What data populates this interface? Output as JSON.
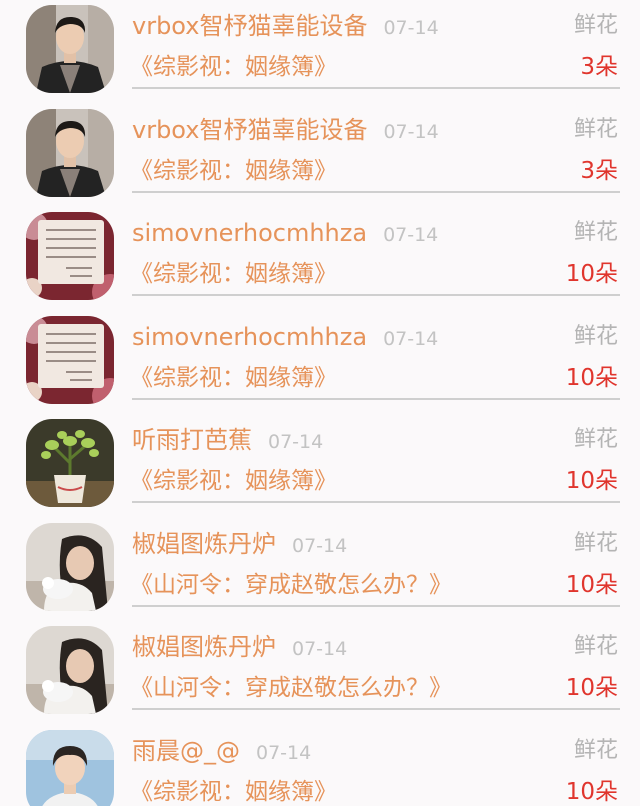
{
  "gifts": [
    {
      "user": "vrbox智杼猫辜能设备",
      "date": "07-14",
      "gift": "鲜花",
      "book": "《综影视：姻缘簿》",
      "count": "3朵",
      "avatar": "man-avatar-icon"
    },
    {
      "user": "vrbox智杼猫辜能设备",
      "date": "07-14",
      "gift": "鲜花",
      "book": "《综影视：姻缘簿》",
      "count": "3朵",
      "avatar": "man-avatar-icon"
    },
    {
      "user": "simovnerhocmhhza",
      "date": "07-14",
      "gift": "鲜花",
      "book": "《综影视：姻缘簿》",
      "count": "10朵",
      "avatar": "poem-card-avatar-icon"
    },
    {
      "user": "simovnerhocmhhza",
      "date": "07-14",
      "gift": "鲜花",
      "book": "《综影视：姻缘簿》",
      "count": "10朵",
      "avatar": "poem-card-avatar-icon"
    },
    {
      "user": "听雨打芭蕉",
      "date": "07-14",
      "gift": "鲜花",
      "book": "《综影视：姻缘簿》",
      "count": "10朵",
      "avatar": "potted-plant-avatar-icon"
    },
    {
      "user": "椒娼图炼丹炉",
      "date": "07-14",
      "gift": "鲜花",
      "book": "《山河令：穿成赵敬怎么办？》",
      "count": "10朵",
      "avatar": "girl-with-cat-avatar-icon"
    },
    {
      "user": "椒娼图炼丹炉",
      "date": "07-14",
      "gift": "鲜花",
      "book": "《山河令：穿成赵敬怎么办？》",
      "count": "10朵",
      "avatar": "girl-with-cat-avatar-icon"
    },
    {
      "user": "雨晨@_@",
      "date": "07-14",
      "gift": "鲜花",
      "book": "《综影视：姻缘簿》",
      "count": "10朵",
      "avatar": "young-man-avatar-icon"
    }
  ],
  "colors": {
    "username": "#e6935a",
    "book_title": "#e6935a",
    "date": "#c3c3c3",
    "gift_label": "#b4b4b4",
    "count": "#e0352d",
    "divider": "#cfcfcf",
    "background": "#fbf9fa"
  }
}
